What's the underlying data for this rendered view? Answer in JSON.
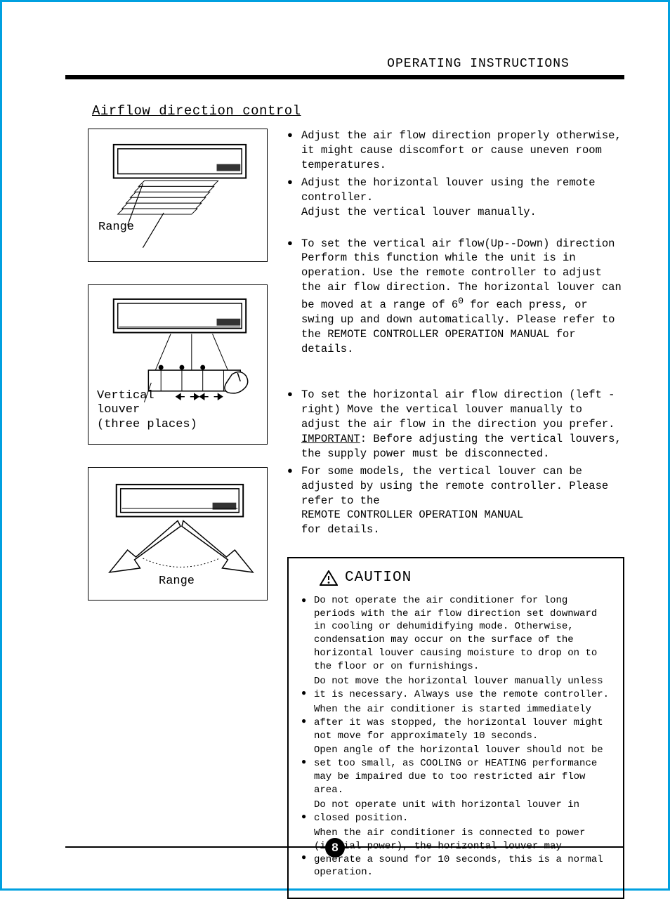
{
  "header": {
    "title": "OPERATING  INSTRUCTIONS"
  },
  "section": {
    "title": "Airflow direction control"
  },
  "figures": {
    "fig1_label": "Range",
    "fig2_label1": "Vertical",
    "fig2_label2": "louver",
    "fig2_label3": "(three places)",
    "fig3_label": "Range"
  },
  "bullets": {
    "b1": "Adjust the air flow direction properly otherwise, it might cause discomfort or  cause uneven room temperatures.",
    "b2a": "Adjust the horizontal louver using the remote controller.",
    "b2b": "Adjust the vertical louver manually.",
    "b3a": "To set the vertical air flow(Up--Down) direction Perform this function while the unit is in operation. Use the remote controller to adjust the air flow direction. The horizontal louver can be moved at a range of 6",
    "b3deg": "0",
    "b3b": " for each press, or swing up and down automatically. Please refer to the    REMOTE CONTROLLER OPERATION MANUAL     for details.",
    "b4a": "To set the horizontal air flow direction (left - right) Move the vertical louver manually to adjust the air flow in the direction you prefer.",
    "b4imp": "IMPORTANT",
    "b4b": ": Before adjusting the vertical louvers, the supply power must be disconnected.",
    "b5a": "For some models, the vertical louver can be adjusted by using the remote controller. Please refer to the",
    "b5b": "  REMOTE CONTROLLER OPERATION MANUAL",
    "b5c": "for details."
  },
  "caution": {
    "title": "CAUTION",
    "c1": "Do not operate the air conditioner for long periods with the air flow direction set downward in cooling or dehumidifying mode. Otherwise, condensation may occur on the surface of the horizontal louver causing  moisture to drop on to the floor or on furnishings.",
    "c2": "Do not move the horizontal louver manually unless it is necessary. Always use the remote controller.",
    "c3": "When the air conditioner is started immediately after it was stopped, the horizontal louver might not move for approximately 10 seconds.",
    "c4": "Open angle of the horizontal louver should not be set too small, as COOLING or HEATING performance may be impaired due to too restricted air flow area.",
    "c5": "Do not operate unit with horizontal louver in closed position.",
    "c6": "When the air conditioner is connected to power (initial power), the horizontal louver may generate a sound for 10 seconds, this is a normal operation."
  },
  "page": {
    "number": "8"
  }
}
